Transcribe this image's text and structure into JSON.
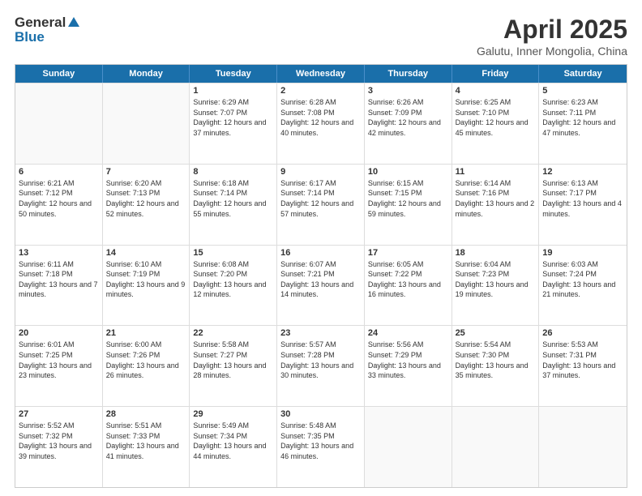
{
  "header": {
    "logo_general": "General",
    "logo_blue": "Blue",
    "title": "April 2025",
    "location": "Galutu, Inner Mongolia, China"
  },
  "weekdays": [
    "Sunday",
    "Monday",
    "Tuesday",
    "Wednesday",
    "Thursday",
    "Friday",
    "Saturday"
  ],
  "rows": [
    [
      {
        "day": "",
        "sunrise": "",
        "sunset": "",
        "daylight": ""
      },
      {
        "day": "",
        "sunrise": "",
        "sunset": "",
        "daylight": ""
      },
      {
        "day": "1",
        "sunrise": "Sunrise: 6:29 AM",
        "sunset": "Sunset: 7:07 PM",
        "daylight": "Daylight: 12 hours and 37 minutes."
      },
      {
        "day": "2",
        "sunrise": "Sunrise: 6:28 AM",
        "sunset": "Sunset: 7:08 PM",
        "daylight": "Daylight: 12 hours and 40 minutes."
      },
      {
        "day": "3",
        "sunrise": "Sunrise: 6:26 AM",
        "sunset": "Sunset: 7:09 PM",
        "daylight": "Daylight: 12 hours and 42 minutes."
      },
      {
        "day": "4",
        "sunrise": "Sunrise: 6:25 AM",
        "sunset": "Sunset: 7:10 PM",
        "daylight": "Daylight: 12 hours and 45 minutes."
      },
      {
        "day": "5",
        "sunrise": "Sunrise: 6:23 AM",
        "sunset": "Sunset: 7:11 PM",
        "daylight": "Daylight: 12 hours and 47 minutes."
      }
    ],
    [
      {
        "day": "6",
        "sunrise": "Sunrise: 6:21 AM",
        "sunset": "Sunset: 7:12 PM",
        "daylight": "Daylight: 12 hours and 50 minutes."
      },
      {
        "day": "7",
        "sunrise": "Sunrise: 6:20 AM",
        "sunset": "Sunset: 7:13 PM",
        "daylight": "Daylight: 12 hours and 52 minutes."
      },
      {
        "day": "8",
        "sunrise": "Sunrise: 6:18 AM",
        "sunset": "Sunset: 7:14 PM",
        "daylight": "Daylight: 12 hours and 55 minutes."
      },
      {
        "day": "9",
        "sunrise": "Sunrise: 6:17 AM",
        "sunset": "Sunset: 7:14 PM",
        "daylight": "Daylight: 12 hours and 57 minutes."
      },
      {
        "day": "10",
        "sunrise": "Sunrise: 6:15 AM",
        "sunset": "Sunset: 7:15 PM",
        "daylight": "Daylight: 12 hours and 59 minutes."
      },
      {
        "day": "11",
        "sunrise": "Sunrise: 6:14 AM",
        "sunset": "Sunset: 7:16 PM",
        "daylight": "Daylight: 13 hours and 2 minutes."
      },
      {
        "day": "12",
        "sunrise": "Sunrise: 6:13 AM",
        "sunset": "Sunset: 7:17 PM",
        "daylight": "Daylight: 13 hours and 4 minutes."
      }
    ],
    [
      {
        "day": "13",
        "sunrise": "Sunrise: 6:11 AM",
        "sunset": "Sunset: 7:18 PM",
        "daylight": "Daylight: 13 hours and 7 minutes."
      },
      {
        "day": "14",
        "sunrise": "Sunrise: 6:10 AM",
        "sunset": "Sunset: 7:19 PM",
        "daylight": "Daylight: 13 hours and 9 minutes."
      },
      {
        "day": "15",
        "sunrise": "Sunrise: 6:08 AM",
        "sunset": "Sunset: 7:20 PM",
        "daylight": "Daylight: 13 hours and 12 minutes."
      },
      {
        "day": "16",
        "sunrise": "Sunrise: 6:07 AM",
        "sunset": "Sunset: 7:21 PM",
        "daylight": "Daylight: 13 hours and 14 minutes."
      },
      {
        "day": "17",
        "sunrise": "Sunrise: 6:05 AM",
        "sunset": "Sunset: 7:22 PM",
        "daylight": "Daylight: 13 hours and 16 minutes."
      },
      {
        "day": "18",
        "sunrise": "Sunrise: 6:04 AM",
        "sunset": "Sunset: 7:23 PM",
        "daylight": "Daylight: 13 hours and 19 minutes."
      },
      {
        "day": "19",
        "sunrise": "Sunrise: 6:03 AM",
        "sunset": "Sunset: 7:24 PM",
        "daylight": "Daylight: 13 hours and 21 minutes."
      }
    ],
    [
      {
        "day": "20",
        "sunrise": "Sunrise: 6:01 AM",
        "sunset": "Sunset: 7:25 PM",
        "daylight": "Daylight: 13 hours and 23 minutes."
      },
      {
        "day": "21",
        "sunrise": "Sunrise: 6:00 AM",
        "sunset": "Sunset: 7:26 PM",
        "daylight": "Daylight: 13 hours and 26 minutes."
      },
      {
        "day": "22",
        "sunrise": "Sunrise: 5:58 AM",
        "sunset": "Sunset: 7:27 PM",
        "daylight": "Daylight: 13 hours and 28 minutes."
      },
      {
        "day": "23",
        "sunrise": "Sunrise: 5:57 AM",
        "sunset": "Sunset: 7:28 PM",
        "daylight": "Daylight: 13 hours and 30 minutes."
      },
      {
        "day": "24",
        "sunrise": "Sunrise: 5:56 AM",
        "sunset": "Sunset: 7:29 PM",
        "daylight": "Daylight: 13 hours and 33 minutes."
      },
      {
        "day": "25",
        "sunrise": "Sunrise: 5:54 AM",
        "sunset": "Sunset: 7:30 PM",
        "daylight": "Daylight: 13 hours and 35 minutes."
      },
      {
        "day": "26",
        "sunrise": "Sunrise: 5:53 AM",
        "sunset": "Sunset: 7:31 PM",
        "daylight": "Daylight: 13 hours and 37 minutes."
      }
    ],
    [
      {
        "day": "27",
        "sunrise": "Sunrise: 5:52 AM",
        "sunset": "Sunset: 7:32 PM",
        "daylight": "Daylight: 13 hours and 39 minutes."
      },
      {
        "day": "28",
        "sunrise": "Sunrise: 5:51 AM",
        "sunset": "Sunset: 7:33 PM",
        "daylight": "Daylight: 13 hours and 41 minutes."
      },
      {
        "day": "29",
        "sunrise": "Sunrise: 5:49 AM",
        "sunset": "Sunset: 7:34 PM",
        "daylight": "Daylight: 13 hours and 44 minutes."
      },
      {
        "day": "30",
        "sunrise": "Sunrise: 5:48 AM",
        "sunset": "Sunset: 7:35 PM",
        "daylight": "Daylight: 13 hours and 46 minutes."
      },
      {
        "day": "",
        "sunrise": "",
        "sunset": "",
        "daylight": ""
      },
      {
        "day": "",
        "sunrise": "",
        "sunset": "",
        "daylight": ""
      },
      {
        "day": "",
        "sunrise": "",
        "sunset": "",
        "daylight": ""
      }
    ]
  ]
}
